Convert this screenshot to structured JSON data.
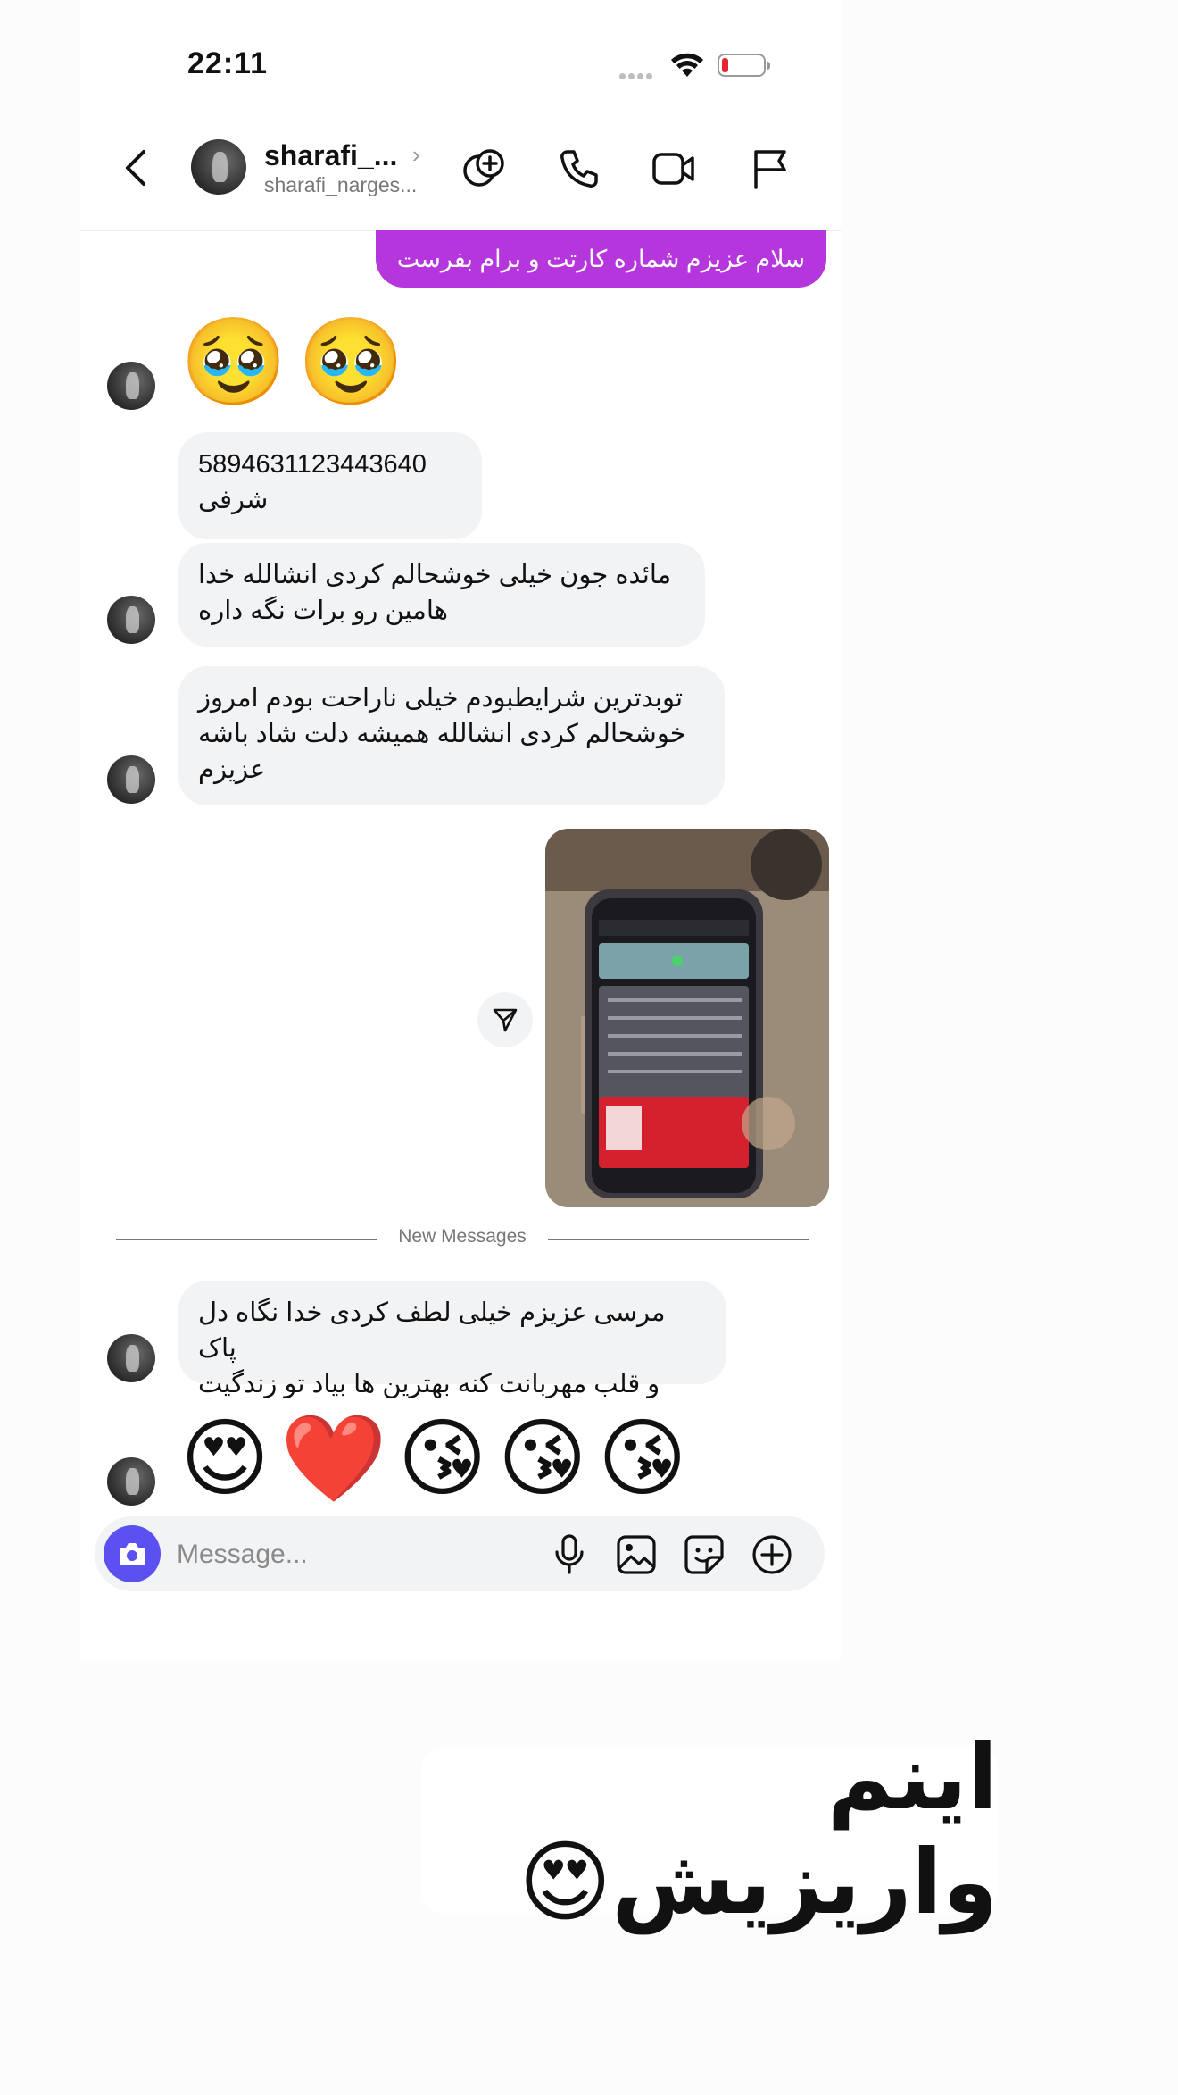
{
  "status": {
    "time": "22:11"
  },
  "header": {
    "username": "sharafi_...",
    "handle": "sharafi_narges..."
  },
  "messages": {
    "outgoing_request": "سلام عزیزم شماره کارتت و برام بفرست",
    "emoji_row_1": [
      "🥹",
      "🥹"
    ],
    "card_number": "5894631123443640",
    "card_name": "شرفی",
    "msg_2_line_1": "مائده جون خیلی خوشحالم کردی انشالله خدا",
    "msg_2_line_2": "هامین رو برات نگه داره",
    "msg_3_line_1": "توبدترین شرایطبودم خیلی ناراحت بودم امروز",
    "msg_3_line_2": "خوشحالم کردی انشالله  همیشه دلت شاد باشه",
    "msg_3_line_3": "عزیزم",
    "new_messages_label": "New Messages",
    "msg_4_line_1": "مرسی عزیزم خیلی لطف کردی خدا نگاه دل پاک",
    "msg_4_line_2": "و قلب مهربانت کنه بهترین ها بیاد تو زندگیت",
    "emoji_row_2": [
      "😍",
      "❤️",
      "😘",
      "😘",
      "😘"
    ]
  },
  "composer": {
    "placeholder": "Message..."
  },
  "caption": "اینم واریزیش😍"
}
